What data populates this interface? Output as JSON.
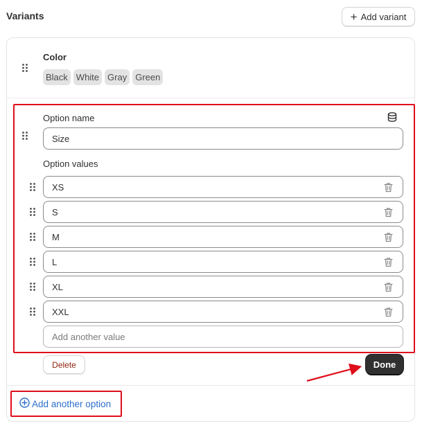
{
  "header": {
    "title": "Variants",
    "add_variant_label": "Add variant"
  },
  "existing_option": {
    "name": "Color",
    "values": [
      "Black",
      "White",
      "Gray",
      "Green"
    ]
  },
  "editing_option": {
    "option_name_label": "Option name",
    "option_name_value": "Size",
    "option_values_label": "Option values",
    "values": [
      "XS",
      "S",
      "M",
      "L",
      "XL",
      "XXL"
    ],
    "add_value_placeholder": "Add another value",
    "delete_label": "Delete",
    "done_label": "Done"
  },
  "footer": {
    "add_option_label": "Add another option"
  },
  "colors": {
    "highlight": "#e00d1b",
    "link": "#2c6ecb",
    "primary_button": "#303030"
  },
  "icons": [
    "plus-icon",
    "drag-handle-icon",
    "database-icon",
    "trash-icon",
    "plus-circle-icon",
    "arrow-annotation"
  ]
}
